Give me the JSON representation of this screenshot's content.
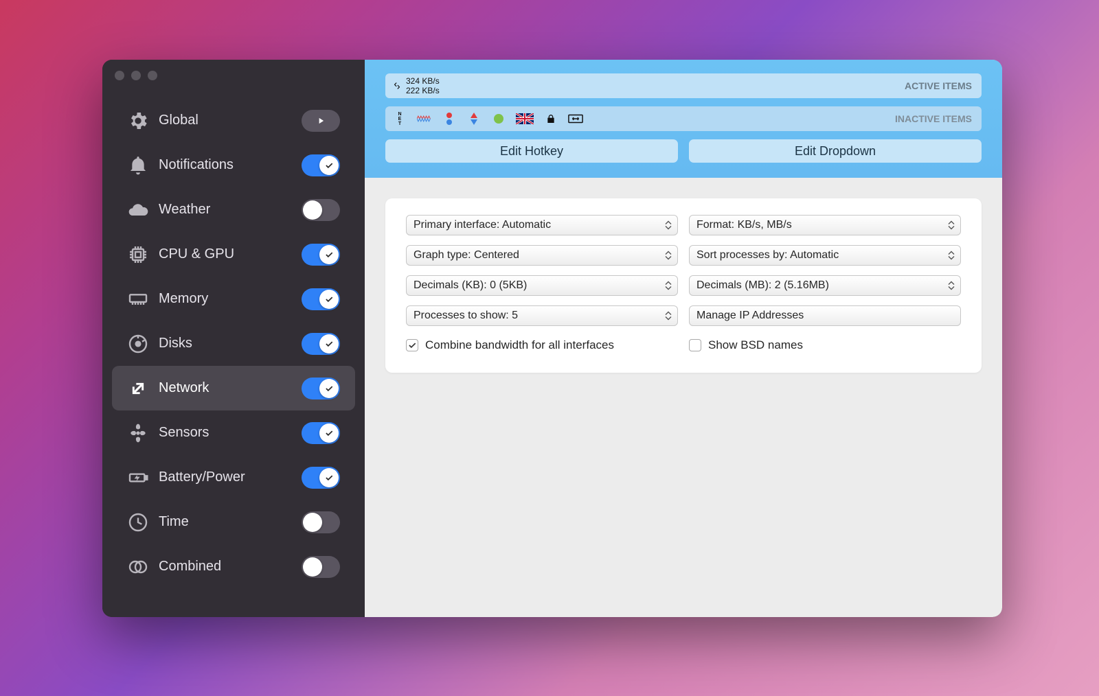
{
  "sidebar": {
    "items": [
      {
        "label": "Global",
        "control": "play"
      },
      {
        "label": "Notifications",
        "control": "toggle",
        "on": true
      },
      {
        "label": "Weather",
        "control": "toggle",
        "on": false
      },
      {
        "label": "CPU & GPU",
        "control": "toggle",
        "on": true
      },
      {
        "label": "Memory",
        "control": "toggle",
        "on": true
      },
      {
        "label": "Disks",
        "control": "toggle",
        "on": true
      },
      {
        "label": "Network",
        "control": "toggle",
        "on": true,
        "selected": true
      },
      {
        "label": "Sensors",
        "control": "toggle",
        "on": true
      },
      {
        "label": "Battery/Power",
        "control": "toggle",
        "on": true
      },
      {
        "label": "Time",
        "control": "toggle",
        "on": false
      },
      {
        "label": "Combined",
        "control": "toggle",
        "on": false
      }
    ]
  },
  "header": {
    "active_label": "ACTIVE ITEMS",
    "inactive_label": "INACTIVE ITEMS",
    "net_up": "324 KB/s",
    "net_down": "222 KB/s",
    "edit_hotkey": "Edit Hotkey",
    "edit_dropdown": "Edit Dropdown"
  },
  "settings": {
    "primary_interface": "Primary interface: Automatic",
    "format": "Format: KB/s, MB/s",
    "graph_type": "Graph type: Centered",
    "sort_processes": "Sort processes by: Automatic",
    "decimals_kb": "Decimals (KB): 0 (5KB)",
    "decimals_mb": "Decimals (MB): 2 (5.16MB)",
    "processes_to_show": "Processes to show: 5",
    "manage_ip": "Manage IP Addresses",
    "combine_bandwidth": {
      "label": "Combine bandwidth for all interfaces",
      "checked": true
    },
    "show_bsd": {
      "label": "Show BSD names",
      "checked": false
    }
  }
}
